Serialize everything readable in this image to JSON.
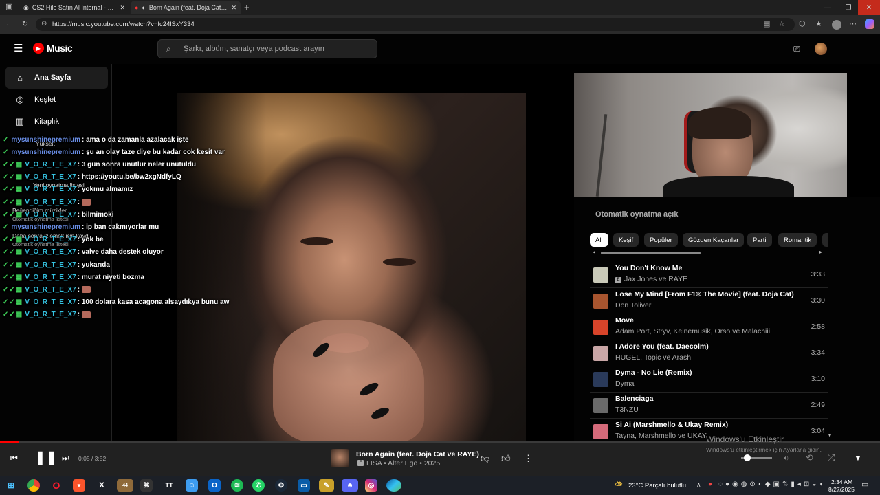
{
  "browser": {
    "tabs": [
      {
        "title": "CS2 Hile Satın Al Internal - CS2 Hi"
      },
      {
        "title": "Born Again (feat. Doja Cat ve"
      }
    ],
    "url": "https://music.youtube.com/watch?v=Ic24lSxY334"
  },
  "app": {
    "logo_text": "Music",
    "search_placeholder": "Şarkı, albüm, sanatçı veya podcast arayın"
  },
  "sidebar": {
    "items": [
      {
        "label": "Ana Sayfa",
        "icon": "home-icon"
      },
      {
        "label": "Keşfet",
        "icon": "compass-icon"
      },
      {
        "label": "Kitaplık",
        "icon": "library-icon"
      }
    ],
    "ghost": {
      "upgrade": "Yükselt",
      "new_playlist": "Yeni oynatma listesi",
      "liked": "Beğendiğim müzikler",
      "auto_playlist_1": "Otomatik oynatma listesi",
      "watch_later": "Daha sonra izlemek için kayd...",
      "auto_playlist_2": "Otomatik oynatma listesi"
    }
  },
  "chat": [
    {
      "user": "mysunshinepremium",
      "msg": ": ama o da zamanla azalacak işte",
      "color": "#6a8fe8"
    },
    {
      "user": "mysunshinepremium",
      "msg": ": şu an olay taze diye bu kadar cok kesit var",
      "color": "#6a8fe8"
    },
    {
      "user": "V_O_R_T_E_X7",
      "msg": ": 3 gün sonra unutlur neler unutuldu",
      "color": "#35c2e0"
    },
    {
      "user": "V_O_R_T_E_X7",
      "msg": ": https://youtu.be/bw2xgNdfyLQ",
      "color": "#35c2e0"
    },
    {
      "user": "V_O_R_T_E_X7",
      "msg": ": yokmu almamız",
      "color": "#35c2e0"
    },
    {
      "user": "V_O_R_T_E_X7",
      "msg": ":",
      "color": "#35c2e0",
      "emote": true
    },
    {
      "user": "V_O_R_T_E_X7",
      "msg": ": bilmimoki",
      "color": "#35c2e0"
    },
    {
      "user": "mysunshinepremium",
      "msg": ": ip ban cakmıyorlar mu",
      "color": "#6a8fe8"
    },
    {
      "user": "V_O_R_T_E_X7",
      "msg": ": yok be",
      "color": "#35c2e0"
    },
    {
      "user": "V_O_R_T_E_X7",
      "msg": ": valve daha destek oluyor",
      "color": "#35c2e0"
    },
    {
      "user": "V_O_R_T_E_X7",
      "msg": ": yukarıda",
      "color": "#35c2e0"
    },
    {
      "user": "V_O_R_T_E_X7",
      "msg": ": murat niyeti bozma",
      "color": "#35c2e0"
    },
    {
      "user": "V_O_R_T_E_X7",
      "msg": ":",
      "color": "#35c2e0",
      "emote": true
    },
    {
      "user": "V_O_R_T_E_X7",
      "msg": ": 100 dolara kasa acagona alsaydıkya bunu aw",
      "color": "#35c2e0"
    },
    {
      "user": "V_O_R_T_E_X7",
      "msg": ":",
      "color": "#35c2e0",
      "emote": true
    }
  ],
  "queue": {
    "header": "Otomatik oynatma açık",
    "chips": [
      "All",
      "Keşif",
      "Popüler",
      "Gözden Kaçanlar",
      "Parti",
      "Romantik"
    ],
    "items": [
      {
        "title": "You Don't Know Me",
        "artist": "Jax Jones ve RAYE",
        "duration": "3:33",
        "thumb": "#c9c9b8",
        "explicit": true
      },
      {
        "title": "Lose My Mind [From F1® The Movie] (feat. Doja Cat)",
        "artist": "Don Toliver",
        "duration": "3:30",
        "thumb": "#a8552f",
        "explicit": false
      },
      {
        "title": "Move",
        "artist": "Adam Port, Stryv, Keinemusik, Orso ve Malachiii",
        "duration": "2:58",
        "thumb": "#d8442a",
        "explicit": false
      },
      {
        "title": "I Adore You (feat. Daecolm)",
        "artist": "HUGEL, Topic ve Arash",
        "duration": "3:34",
        "thumb": "#c9a6a6",
        "explicit": false
      },
      {
        "title": "Dyma - No Lie (Remix)",
        "artist": "Dyma",
        "duration": "3:10",
        "thumb": "#2a3a5a",
        "explicit": false
      },
      {
        "title": "Balenciaga",
        "artist": "T3NZU",
        "duration": "2:49",
        "thumb": "#6a6a6a",
        "explicit": false
      },
      {
        "title": "Si Ai (Marshmello & Ukay Remix)",
        "artist": "Tayna, Marshmello ve UKAY",
        "duration": "3:04",
        "thumb": "#d46a7a",
        "explicit": false
      }
    ]
  },
  "player": {
    "time": "0:05 / 3:52",
    "progress_fraction": 0.022,
    "title": "Born Again (feat. Doja Cat ve RAYE)",
    "meta": "LISA • Alter Ego • 2025"
  },
  "watermark": {
    "line1": "Windows'u Etkinleştir",
    "line2": "Windows'u etkinleştirmek için Ayarlar'a gidin."
  },
  "taskbar": {
    "weather": "23°C  Parçalı bulutlu",
    "time": "2:34 AM",
    "date": "8/27/2025",
    "notification_badge": "44"
  },
  "colors": {
    "accent_red": "#ff0000",
    "chat_badge_green": "#3fcf59"
  }
}
